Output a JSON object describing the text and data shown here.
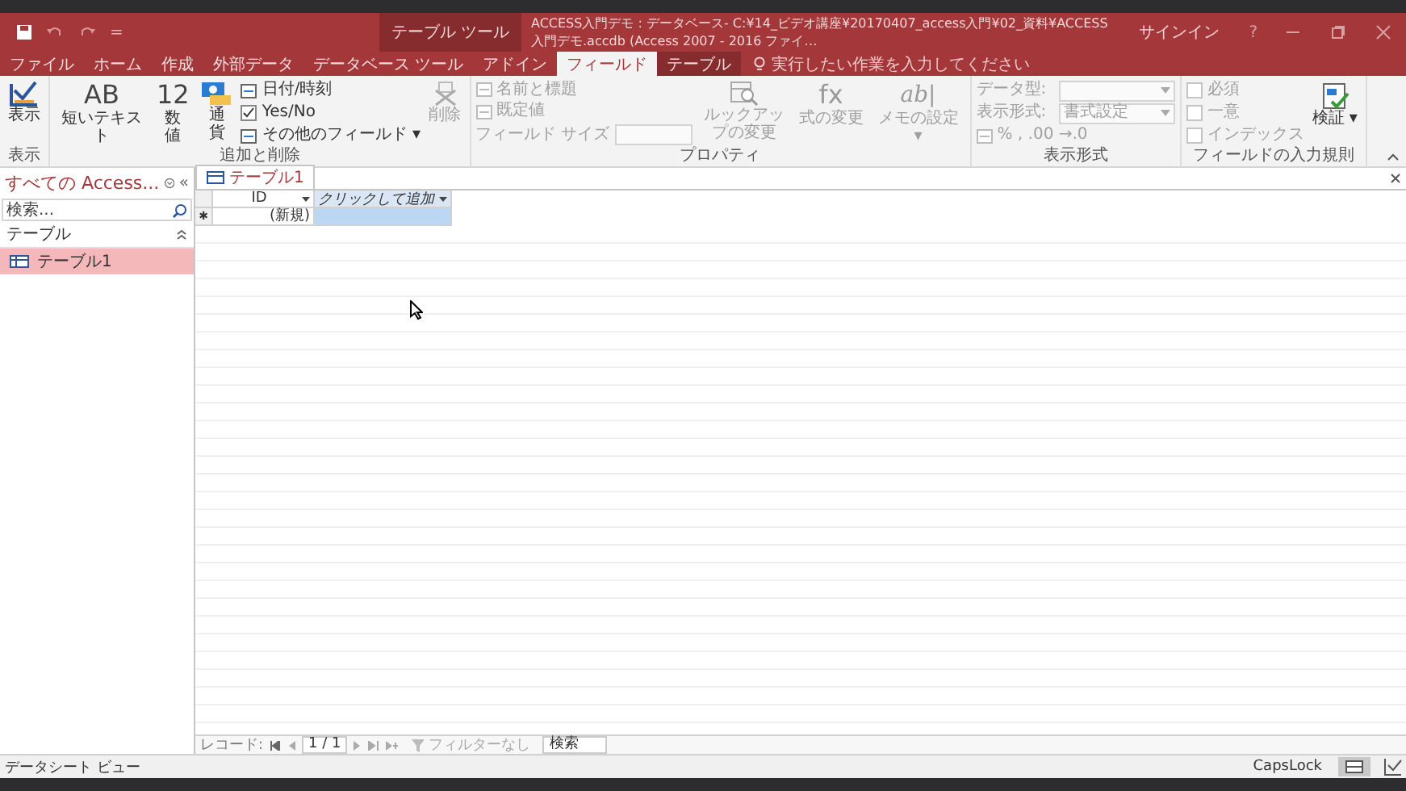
{
  "quick_access": {
    "customize": "="
  },
  "title_bar": {
    "context_label": "テーブル ツール",
    "title": "ACCESS入門デモ : データベース- C:¥14_ビデオ講座¥20170407_access入門¥02_資料¥ACCESS入門デモ.accdb (Access 2007 - 2016 ファイ…",
    "signin": "サインイン",
    "help": "?"
  },
  "tabs": [
    {
      "label": "ファイル",
      "selected": false,
      "contextual": false
    },
    {
      "label": "ホーム",
      "selected": false,
      "contextual": false
    },
    {
      "label": "作成",
      "selected": false,
      "contextual": false
    },
    {
      "label": "外部データ",
      "selected": false,
      "contextual": false
    },
    {
      "label": "データベース ツール",
      "selected": false,
      "contextual": false
    },
    {
      "label": "アドイン",
      "selected": false,
      "contextual": false
    },
    {
      "label": "フィールド",
      "selected": true,
      "contextual": true
    },
    {
      "label": "テーブル",
      "selected": false,
      "contextual": true
    }
  ],
  "tell_me": {
    "placeholder": "実行したい作業を入力してください"
  },
  "ribbon": [
    {
      "label": "表示",
      "columns": [
        [
          {
            "kind": "view",
            "label": "表示",
            "disabled": false
          }
        ]
      ]
    },
    {
      "label": "追加と削除",
      "columns": [
        [
          {
            "kind": "glyph",
            "glyph": "AB",
            "label": "短いテキスト",
            "disabled": false
          }
        ],
        [
          {
            "kind": "glyph",
            "glyph": "12",
            "label": "数値",
            "disabled": false,
            "narrow": true
          }
        ],
        [
          {
            "kind": "currency",
            "label": "通貨",
            "disabled": false,
            "narrow": true
          }
        ],
        [
          {
            "kind": "small",
            "label": "日付/時刻",
            "disabled": false
          },
          {
            "kind": "checkbox",
            "label": "Yes/No",
            "checked": true,
            "disabled": false
          },
          {
            "kind": "small",
            "label": "その他のフィールド ▾",
            "disabled": false
          }
        ],
        [
          {
            "kind": "delete",
            "label": "削除",
            "disabled": true
          }
        ]
      ]
    },
    {
      "label": "プロパティ",
      "columns": [
        [
          {
            "kind": "small",
            "label": "名前と標題",
            "disabled": true
          },
          {
            "kind": "small",
            "label": "既定値",
            "disabled": true
          },
          {
            "kind": "input",
            "label": "フィールド サイズ",
            "disabled": true
          }
        ],
        [
          {
            "kind": "lookup",
            "label": "ルックアップの変更",
            "disabled": true
          }
        ],
        [
          {
            "kind": "glyph",
            "glyph": "fx",
            "label": "式の変更",
            "disabled": true
          }
        ],
        [
          {
            "kind": "glyph",
            "glyph": "ab|",
            "label": "メモの設定 ▾",
            "disabled": true
          }
        ]
      ]
    },
    {
      "label": "表示形式",
      "columns": [
        [
          {
            "kind": "dropdown",
            "label": "データ型:",
            "disabled": true
          },
          {
            "kind": "dropdown",
            "label": "表示形式:",
            "value": "書式設定",
            "disabled": true
          },
          {
            "kind": "small",
            "label": "% ,  .00 →.0",
            "disabled": true
          }
        ]
      ]
    },
    {
      "label": "フィールドの入力規則",
      "columns": [
        [
          {
            "kind": "checkbox",
            "label": "必須",
            "checked": false,
            "disabled": true
          },
          {
            "kind": "checkbox",
            "label": "一意",
            "checked": false,
            "disabled": true
          },
          {
            "kind": "checkbox",
            "label": "インデックス",
            "checked": false,
            "disabled": true
          }
        ],
        [
          {
            "kind": "validate",
            "label": "検証 ▾",
            "disabled": false
          }
        ]
      ]
    }
  ],
  "nav_pane": {
    "title": "すべての Access...",
    "collapse": "«",
    "search": {
      "placeholder": "検索..."
    },
    "section": "テーブル",
    "items": [
      {
        "label": "テーブル1",
        "selected": true
      }
    ]
  },
  "document_tab": {
    "label": "テーブル1"
  },
  "datasheet": {
    "columns": [
      {
        "label": "ID",
        "selected": false
      },
      {
        "label": "クリックして追加",
        "selected": true
      }
    ],
    "new_row": {
      "marker": "✱",
      "cells": [
        "(新規)",
        ""
      ]
    }
  },
  "record_nav": {
    "label": "レコード:",
    "position": "1 / 1",
    "filter": "フィルターなし",
    "search": {
      "placeholder": "検索"
    }
  },
  "status_bar": {
    "view": "データシート ビュー",
    "caps_lock": "CapsLock"
  }
}
